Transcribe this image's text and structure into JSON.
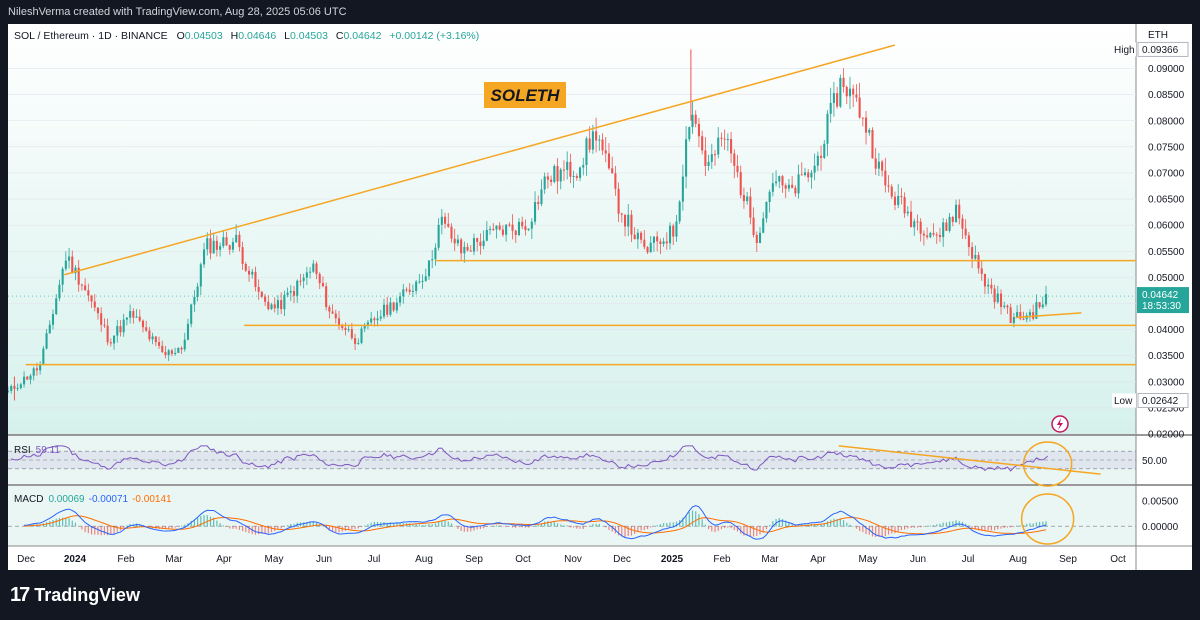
{
  "header": {
    "credit": "NileshVerma created with TradingView.com, Aug 28, 2025 05:06 UTC"
  },
  "legend": {
    "symbol": "SOL / Ethereum · 1D · BINANCE",
    "o_label": "O",
    "o_val": "0.04503",
    "h_label": "H",
    "h_val": "0.04646",
    "l_label": "L",
    "l_val": "0.04503",
    "c_label": "C",
    "c_val": "0.04642",
    "change": "+0.00142 (+3.16%)"
  },
  "annotation": {
    "title": "SOLETH"
  },
  "price_axis": {
    "currency": "ETH",
    "ticks": [
      "0.09000",
      "0.08500",
      "0.08000",
      "0.07500",
      "0.07000",
      "0.06500",
      "0.06000",
      "0.05500",
      "0.05000",
      "0.04500",
      "0.04000",
      "0.03500",
      "0.03000",
      "0.02500",
      "0.02000"
    ],
    "high_label": "High",
    "high_value": "0.09366",
    "low_label": "Low",
    "low_value": "0.02642",
    "last_price": "0.04642",
    "countdown": "18:53:30"
  },
  "rsi": {
    "label": "RSI",
    "value": "59.11",
    "level": "50.00"
  },
  "macd": {
    "label": "MACD",
    "v1": "0.00069",
    "v2": "-0.00071",
    "v3": "-0.00141",
    "ticks": [
      "0.00500",
      "0.00000"
    ]
  },
  "time_axis": [
    "Dec",
    "2024",
    "Feb",
    "Mar",
    "Apr",
    "May",
    "Jun",
    "Jul",
    "Aug",
    "Sep",
    "Oct",
    "Nov",
    "Dec",
    "2025",
    "Feb",
    "Mar",
    "Apr",
    "May",
    "Jun",
    "Jul",
    "Aug",
    "Sep",
    "Oct"
  ],
  "footer": {
    "brand": "TradingView"
  },
  "colors": {
    "up": "#26a69a",
    "down": "#ef5350",
    "trendline": "#f5a623",
    "rsi_line": "#7e57c2",
    "macd_line": "#2962ff",
    "signal_line": "#ff6d00",
    "background_top": "#ffffff",
    "background_bottom": "#d6f1ec",
    "price_tag": "#26a69a"
  },
  "chart_data": {
    "type": "candlestick",
    "title": "SOLETH",
    "symbol": "SOL / Ethereum",
    "interval": "1D",
    "exchange": "BINANCE",
    "y_range": [
      0.02,
      0.097
    ],
    "x_range": [
      "2023-11-20",
      "2025-10-22"
    ],
    "close_path": [
      [
        "2023-11-20",
        0.028
      ],
      [
        "2023-12-10",
        0.033
      ],
      [
        "2023-12-26",
        0.054
      ],
      [
        "2024-01-05",
        0.049
      ],
      [
        "2024-01-22",
        0.038
      ],
      [
        "2024-02-05",
        0.043
      ],
      [
        "2024-02-25",
        0.035
      ],
      [
        "2024-03-08",
        0.037
      ],
      [
        "2024-03-22",
        0.056
      ],
      [
        "2024-04-10",
        0.057
      ],
      [
        "2024-04-25",
        0.046
      ],
      [
        "2024-05-05",
        0.044
      ],
      [
        "2024-05-20",
        0.049
      ],
      [
        "2024-05-28",
        0.052
      ],
      [
        "2024-06-08",
        0.043
      ],
      [
        "2024-06-24",
        0.038
      ],
      [
        "2024-07-05",
        0.042
      ],
      [
        "2024-07-25",
        0.047
      ],
      [
        "2024-08-08",
        0.052
      ],
      [
        "2024-08-15",
        0.061
      ],
      [
        "2024-08-28",
        0.055
      ],
      [
        "2024-09-20",
        0.059
      ],
      [
        "2024-10-08",
        0.06
      ],
      [
        "2024-10-20",
        0.069
      ],
      [
        "2024-11-08",
        0.071
      ],
      [
        "2024-11-20",
        0.078
      ],
      [
        "2024-12-05",
        0.063
      ],
      [
        "2024-12-20",
        0.055
      ],
      [
        "2025-01-08",
        0.059
      ],
      [
        "2025-01-18",
        0.083
      ],
      [
        "2025-01-28",
        0.071
      ],
      [
        "2025-02-08",
        0.077
      ],
      [
        "2025-02-28",
        0.058
      ],
      [
        "2025-03-10",
        0.069
      ],
      [
        "2025-03-20",
        0.066
      ],
      [
        "2025-04-05",
        0.071
      ],
      [
        "2025-04-22",
        0.088
      ],
      [
        "2025-05-05",
        0.081
      ],
      [
        "2025-05-18",
        0.068
      ],
      [
        "2025-06-05",
        0.061
      ],
      [
        "2025-06-22",
        0.058
      ],
      [
        "2025-07-02",
        0.063
      ],
      [
        "2025-07-18",
        0.05
      ],
      [
        "2025-08-06",
        0.042
      ],
      [
        "2025-08-18",
        0.043
      ],
      [
        "2025-08-28",
        0.04642
      ]
    ],
    "extremes": {
      "high": 0.09366,
      "low": 0.02642,
      "last": 0.04642
    },
    "trendlines": [
      {
        "from": [
          "2023-12-25",
          0.0505
        ],
        "to": [
          "2025-05-25",
          0.0945
        ]
      },
      {
        "from": [
          "2024-08-12",
          0.0532
        ],
        "to": [
          "2025-10-22",
          0.0532
        ]
      },
      {
        "from": [
          "2024-04-15",
          0.0408
        ],
        "to": [
          "2025-10-22",
          0.0408
        ]
      },
      {
        "from": [
          "2023-12-01",
          0.0333
        ],
        "to": [
          "2025-10-22",
          0.0333
        ]
      },
      {
        "from": [
          "2025-08-08",
          0.0423
        ],
        "to": [
          "2025-09-18",
          0.0432
        ]
      }
    ],
    "rsi": {
      "upper": 70,
      "lower": 30,
      "mid": 50,
      "last": 59.11,
      "downtrend": {
        "from": [
          "2025-04-20",
          82
        ],
        "to": [
          "2025-09-30",
          18
        ]
      }
    },
    "macd": {
      "macd": 0.00069,
      "signal": -0.00071,
      "hist": -0.00141
    }
  }
}
